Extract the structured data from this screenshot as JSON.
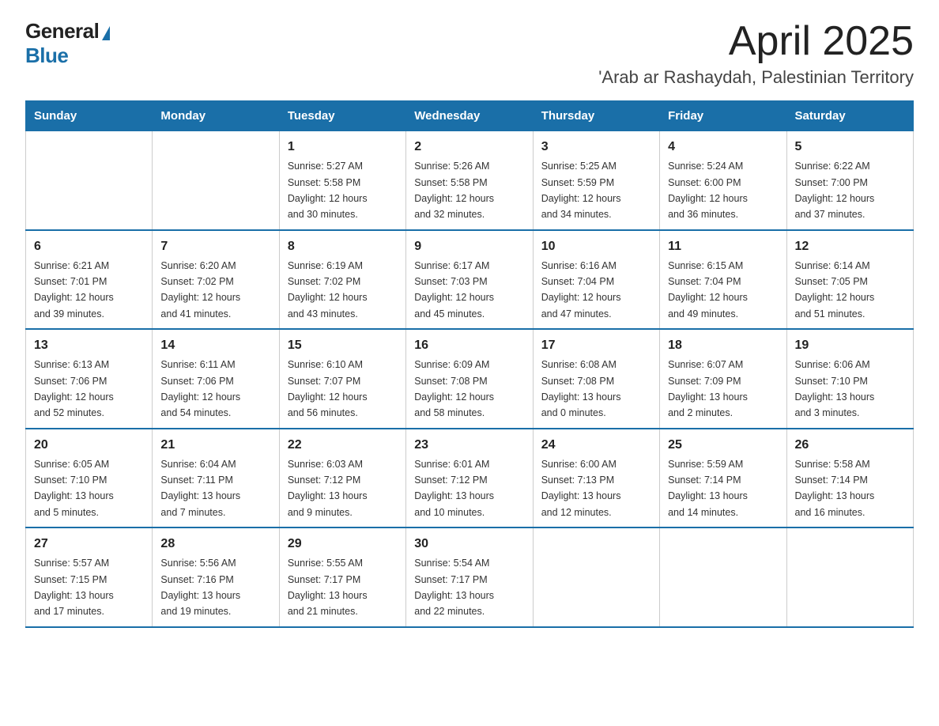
{
  "logo": {
    "general": "General",
    "blue": "Blue"
  },
  "title": "April 2025",
  "subtitle": "'Arab ar Rashaydah, Palestinian Territory",
  "days_of_week": [
    "Sunday",
    "Monday",
    "Tuesday",
    "Wednesday",
    "Thursday",
    "Friday",
    "Saturday"
  ],
  "weeks": [
    [
      {
        "day": "",
        "info": ""
      },
      {
        "day": "",
        "info": ""
      },
      {
        "day": "1",
        "info": "Sunrise: 5:27 AM\nSunset: 5:58 PM\nDaylight: 12 hours\nand 30 minutes."
      },
      {
        "day": "2",
        "info": "Sunrise: 5:26 AM\nSunset: 5:58 PM\nDaylight: 12 hours\nand 32 minutes."
      },
      {
        "day": "3",
        "info": "Sunrise: 5:25 AM\nSunset: 5:59 PM\nDaylight: 12 hours\nand 34 minutes."
      },
      {
        "day": "4",
        "info": "Sunrise: 5:24 AM\nSunset: 6:00 PM\nDaylight: 12 hours\nand 36 minutes."
      },
      {
        "day": "5",
        "info": "Sunrise: 6:22 AM\nSunset: 7:00 PM\nDaylight: 12 hours\nand 37 minutes."
      }
    ],
    [
      {
        "day": "6",
        "info": "Sunrise: 6:21 AM\nSunset: 7:01 PM\nDaylight: 12 hours\nand 39 minutes."
      },
      {
        "day": "7",
        "info": "Sunrise: 6:20 AM\nSunset: 7:02 PM\nDaylight: 12 hours\nand 41 minutes."
      },
      {
        "day": "8",
        "info": "Sunrise: 6:19 AM\nSunset: 7:02 PM\nDaylight: 12 hours\nand 43 minutes."
      },
      {
        "day": "9",
        "info": "Sunrise: 6:17 AM\nSunset: 7:03 PM\nDaylight: 12 hours\nand 45 minutes."
      },
      {
        "day": "10",
        "info": "Sunrise: 6:16 AM\nSunset: 7:04 PM\nDaylight: 12 hours\nand 47 minutes."
      },
      {
        "day": "11",
        "info": "Sunrise: 6:15 AM\nSunset: 7:04 PM\nDaylight: 12 hours\nand 49 minutes."
      },
      {
        "day": "12",
        "info": "Sunrise: 6:14 AM\nSunset: 7:05 PM\nDaylight: 12 hours\nand 51 minutes."
      }
    ],
    [
      {
        "day": "13",
        "info": "Sunrise: 6:13 AM\nSunset: 7:06 PM\nDaylight: 12 hours\nand 52 minutes."
      },
      {
        "day": "14",
        "info": "Sunrise: 6:11 AM\nSunset: 7:06 PM\nDaylight: 12 hours\nand 54 minutes."
      },
      {
        "day": "15",
        "info": "Sunrise: 6:10 AM\nSunset: 7:07 PM\nDaylight: 12 hours\nand 56 minutes."
      },
      {
        "day": "16",
        "info": "Sunrise: 6:09 AM\nSunset: 7:08 PM\nDaylight: 12 hours\nand 58 minutes."
      },
      {
        "day": "17",
        "info": "Sunrise: 6:08 AM\nSunset: 7:08 PM\nDaylight: 13 hours\nand 0 minutes."
      },
      {
        "day": "18",
        "info": "Sunrise: 6:07 AM\nSunset: 7:09 PM\nDaylight: 13 hours\nand 2 minutes."
      },
      {
        "day": "19",
        "info": "Sunrise: 6:06 AM\nSunset: 7:10 PM\nDaylight: 13 hours\nand 3 minutes."
      }
    ],
    [
      {
        "day": "20",
        "info": "Sunrise: 6:05 AM\nSunset: 7:10 PM\nDaylight: 13 hours\nand 5 minutes."
      },
      {
        "day": "21",
        "info": "Sunrise: 6:04 AM\nSunset: 7:11 PM\nDaylight: 13 hours\nand 7 minutes."
      },
      {
        "day": "22",
        "info": "Sunrise: 6:03 AM\nSunset: 7:12 PM\nDaylight: 13 hours\nand 9 minutes."
      },
      {
        "day": "23",
        "info": "Sunrise: 6:01 AM\nSunset: 7:12 PM\nDaylight: 13 hours\nand 10 minutes."
      },
      {
        "day": "24",
        "info": "Sunrise: 6:00 AM\nSunset: 7:13 PM\nDaylight: 13 hours\nand 12 minutes."
      },
      {
        "day": "25",
        "info": "Sunrise: 5:59 AM\nSunset: 7:14 PM\nDaylight: 13 hours\nand 14 minutes."
      },
      {
        "day": "26",
        "info": "Sunrise: 5:58 AM\nSunset: 7:14 PM\nDaylight: 13 hours\nand 16 minutes."
      }
    ],
    [
      {
        "day": "27",
        "info": "Sunrise: 5:57 AM\nSunset: 7:15 PM\nDaylight: 13 hours\nand 17 minutes."
      },
      {
        "day": "28",
        "info": "Sunrise: 5:56 AM\nSunset: 7:16 PM\nDaylight: 13 hours\nand 19 minutes."
      },
      {
        "day": "29",
        "info": "Sunrise: 5:55 AM\nSunset: 7:17 PM\nDaylight: 13 hours\nand 21 minutes."
      },
      {
        "day": "30",
        "info": "Sunrise: 5:54 AM\nSunset: 7:17 PM\nDaylight: 13 hours\nand 22 minutes."
      },
      {
        "day": "",
        "info": ""
      },
      {
        "day": "",
        "info": ""
      },
      {
        "day": "",
        "info": ""
      }
    ]
  ]
}
